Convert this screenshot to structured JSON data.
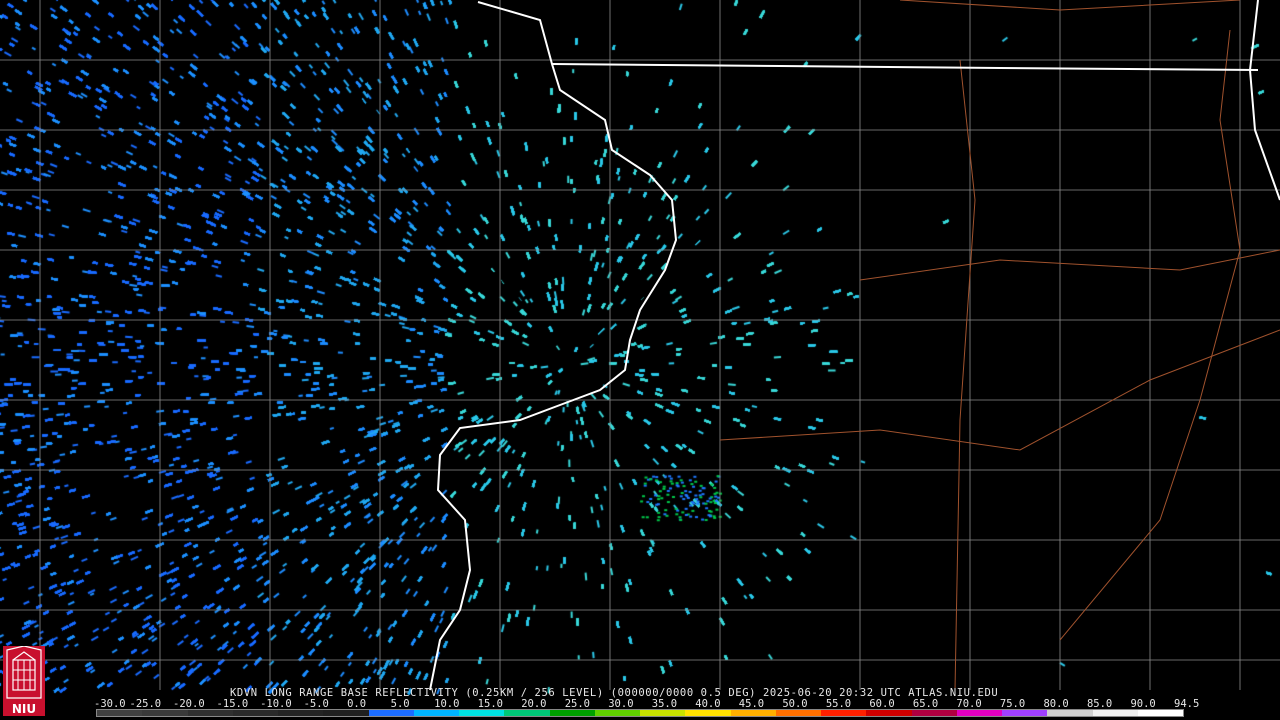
{
  "product_caption": "KDVN LONG RANGE BASE REFLECTIVITY (0.25KM / 256 LEVEL) (000000/0000 0.5 DEG) 2025-06-20 20:32 UTC  ATLAS.NIU.EDU",
  "scale_labels": [
    "-30.0",
    "-25.0",
    "-20.0",
    "-15.0",
    "-10.0",
    "-5.0",
    "0.0",
    "5.0",
    "10.0",
    "15.0",
    "20.0",
    "25.0",
    "30.0",
    "35.0",
    "40.0",
    "45.0",
    "50.0",
    "55.0",
    "60.0",
    "65.0",
    "70.0",
    "75.0",
    "80.0",
    "85.0",
    "90.0",
    "94.5"
  ],
  "colorbar_colors": [
    "#404040",
    "#3a3a3a",
    "#303030",
    "#2a2a2a",
    "#242424",
    "#202020",
    "#1c6cff",
    "#00b4ff",
    "#00e0e0",
    "#00c878",
    "#00a000",
    "#60d000",
    "#c8e000",
    "#ffe000",
    "#ffb000",
    "#ff7000",
    "#ff2000",
    "#d00000",
    "#b00040",
    "#e000c0",
    "#a040ff",
    "#d0d0d0",
    "#f0f0f0",
    "#ffffff"
  ],
  "logo_label": "NIU",
  "colors": {
    "background": "#000000",
    "state_border": "#ffffff",
    "county_border": "#8c8c8c",
    "highway": "#a0522d"
  }
}
